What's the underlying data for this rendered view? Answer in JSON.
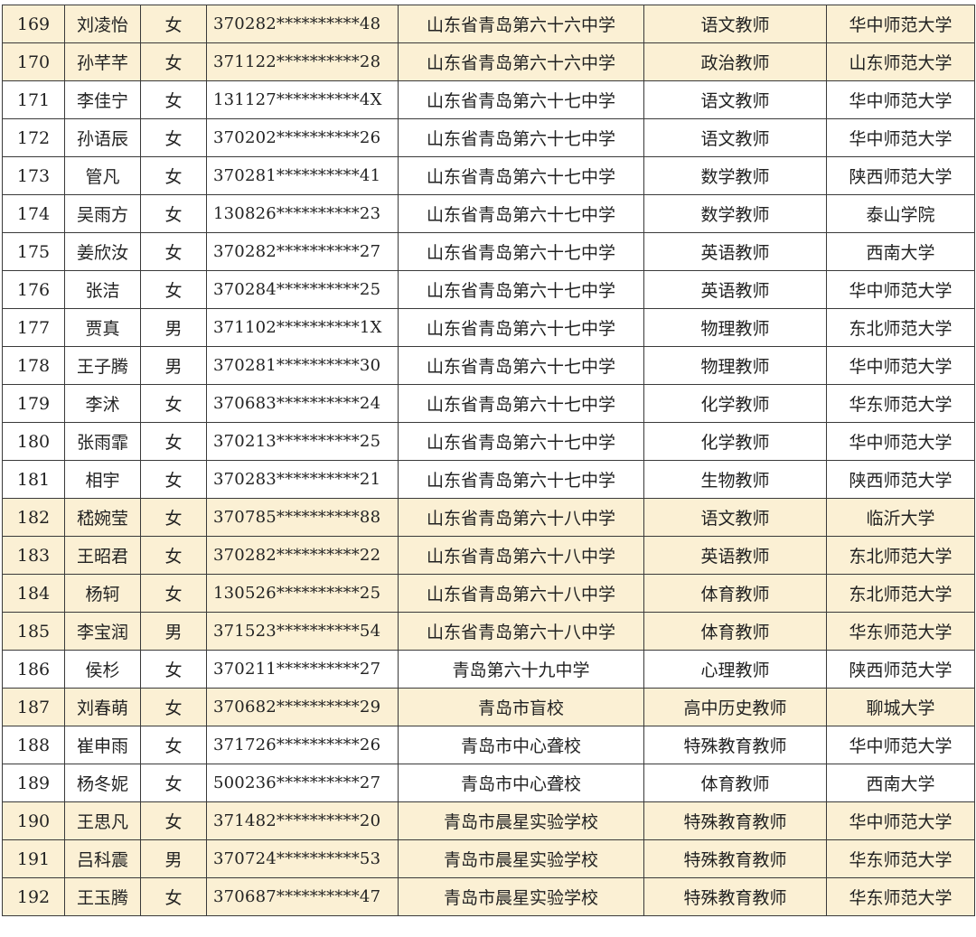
{
  "colors": {
    "highlight_row": "#fbf0d4",
    "plain_row": "#ffffff",
    "border": "#3a3a3a"
  },
  "rows": [
    {
      "no": "169",
      "name": "刘凌怡",
      "gender": "女",
      "id": "370282**********48",
      "school": "山东省青岛第六十六中学",
      "position": "语文教师",
      "university": "华中师范大学",
      "highlight": true
    },
    {
      "no": "170",
      "name": "孙芊芊",
      "gender": "女",
      "id": "371122**********28",
      "school": "山东省青岛第六十六中学",
      "position": "政治教师",
      "university": "山东师范大学",
      "highlight": true
    },
    {
      "no": "171",
      "name": "李佳宁",
      "gender": "女",
      "id": "131127**********4X",
      "school": "山东省青岛第六十七中学",
      "position": "语文教师",
      "university": "华中师范大学",
      "highlight": false
    },
    {
      "no": "172",
      "name": "孙语辰",
      "gender": "女",
      "id": "370202**********26",
      "school": "山东省青岛第六十七中学",
      "position": "语文教师",
      "university": "华中师范大学",
      "highlight": false
    },
    {
      "no": "173",
      "name": "管凡",
      "gender": "女",
      "id": "370281**********41",
      "school": "山东省青岛第六十七中学",
      "position": "数学教师",
      "university": "陕西师范大学",
      "highlight": false
    },
    {
      "no": "174",
      "name": "吴雨方",
      "gender": "女",
      "id": "130826**********23",
      "school": "山东省青岛第六十七中学",
      "position": "数学教师",
      "university": "泰山学院",
      "highlight": false
    },
    {
      "no": "175",
      "name": "姜欣汝",
      "gender": "女",
      "id": "370282**********27",
      "school": "山东省青岛第六十七中学",
      "position": "英语教师",
      "university": "西南大学",
      "highlight": false
    },
    {
      "no": "176",
      "name": "张洁",
      "gender": "女",
      "id": "370284**********25",
      "school": "山东省青岛第六十七中学",
      "position": "英语教师",
      "university": "华中师范大学",
      "highlight": false
    },
    {
      "no": "177",
      "name": "贾真",
      "gender": "男",
      "id": "371102**********1X",
      "school": "山东省青岛第六十七中学",
      "position": "物理教师",
      "university": "东北师范大学",
      "highlight": false
    },
    {
      "no": "178",
      "name": "王子腾",
      "gender": "男",
      "id": "370281**********30",
      "school": "山东省青岛第六十七中学",
      "position": "物理教师",
      "university": "华中师范大学",
      "highlight": false
    },
    {
      "no": "179",
      "name": "李沭",
      "gender": "女",
      "id": "370683**********24",
      "school": "山东省青岛第六十七中学",
      "position": "化学教师",
      "university": "华东师范大学",
      "highlight": false
    },
    {
      "no": "180",
      "name": "张雨霏",
      "gender": "女",
      "id": "370213**********25",
      "school": "山东省青岛第六十七中学",
      "position": "化学教师",
      "university": "华中师范大学",
      "highlight": false
    },
    {
      "no": "181",
      "name": "相宇",
      "gender": "女",
      "id": "370283**********21",
      "school": "山东省青岛第六十七中学",
      "position": "生物教师",
      "university": "陕西师范大学",
      "highlight": false
    },
    {
      "no": "182",
      "name": "嵇婉莹",
      "gender": "女",
      "id": "370785**********88",
      "school": "山东省青岛第六十八中学",
      "position": "语文教师",
      "university": "临沂大学",
      "highlight": true
    },
    {
      "no": "183",
      "name": "王昭君",
      "gender": "女",
      "id": "370282**********22",
      "school": "山东省青岛第六十八中学",
      "position": "英语教师",
      "university": "东北师范大学",
      "highlight": true
    },
    {
      "no": "184",
      "name": "杨轲",
      "gender": "女",
      "id": "130526**********25",
      "school": "山东省青岛第六十八中学",
      "position": "体育教师",
      "university": "东北师范大学",
      "highlight": true
    },
    {
      "no": "185",
      "name": "李宝润",
      "gender": "男",
      "id": "371523**********54",
      "school": "山东省青岛第六十八中学",
      "position": "体育教师",
      "university": "华东师范大学",
      "highlight": true
    },
    {
      "no": "186",
      "name": "侯杉",
      "gender": "女",
      "id": "370211**********27",
      "school": "青岛第六十九中学",
      "position": "心理教师",
      "university": "陕西师范大学",
      "highlight": false
    },
    {
      "no": "187",
      "name": "刘春萌",
      "gender": "女",
      "id": "370682**********29",
      "school": "青岛市盲校",
      "position": "高中历史教师",
      "university": "聊城大学",
      "highlight": true
    },
    {
      "no": "188",
      "name": "崔申雨",
      "gender": "女",
      "id": "371726**********26",
      "school": "青岛市中心聋校",
      "position": "特殊教育教师",
      "university": "华中师范大学",
      "highlight": false
    },
    {
      "no": "189",
      "name": "杨冬妮",
      "gender": "女",
      "id": "500236**********27",
      "school": "青岛市中心聋校",
      "position": "体育教师",
      "university": "西南大学",
      "highlight": false
    },
    {
      "no": "190",
      "name": "王思凡",
      "gender": "女",
      "id": "371482**********20",
      "school": "青岛市晨星实验学校",
      "position": "特殊教育教师",
      "university": "华中师范大学",
      "highlight": true
    },
    {
      "no": "191",
      "name": "吕科震",
      "gender": "男",
      "id": "370724**********53",
      "school": "青岛市晨星实验学校",
      "position": "特殊教育教师",
      "university": "华东师范大学",
      "highlight": true
    },
    {
      "no": "192",
      "name": "王玉腾",
      "gender": "女",
      "id": "370687**********47",
      "school": "青岛市晨星实验学校",
      "position": "特殊教育教师",
      "university": "华东师范大学",
      "highlight": true
    }
  ]
}
